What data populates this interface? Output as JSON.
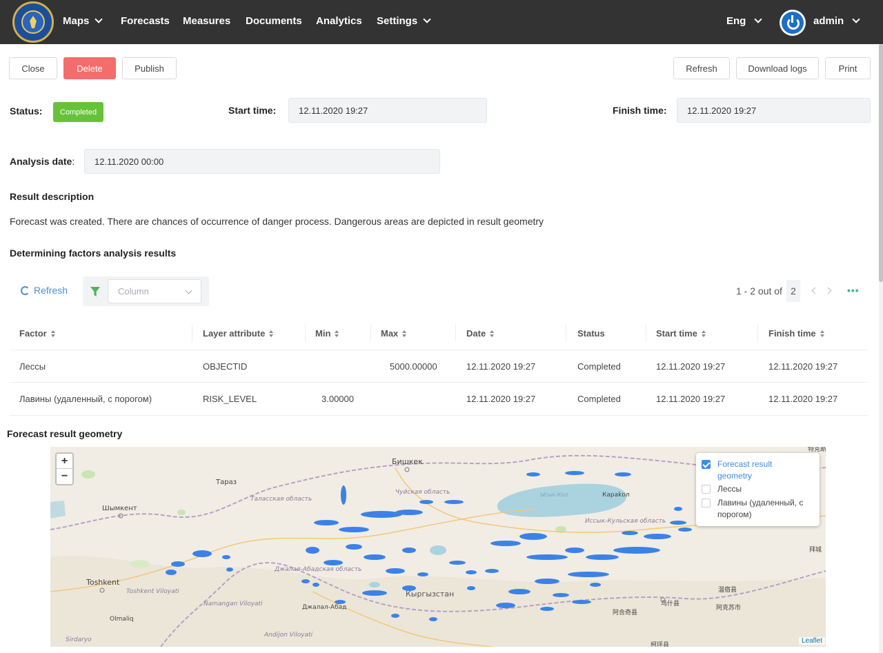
{
  "nav": {
    "items": [
      {
        "label": "Maps",
        "dropdown": true
      },
      {
        "label": "Forecasts",
        "dropdown": false
      },
      {
        "label": "Measures",
        "dropdown": false
      },
      {
        "label": "Documents",
        "dropdown": false
      },
      {
        "label": "Analytics",
        "dropdown": false
      },
      {
        "label": "Settings",
        "dropdown": true
      }
    ],
    "language": "Eng",
    "user": "admin"
  },
  "actions": {
    "close": "Close",
    "delete": "Delete",
    "publish": "Publish",
    "refresh": "Refresh",
    "download_logs": "Download logs",
    "print": "Print"
  },
  "details": {
    "status_label": "Status:",
    "status_value": "Completed",
    "start_label": "Start time:",
    "start_value": "12.11.2020 19:27",
    "finish_label": "Finish time:",
    "finish_value": "12.11.2020 19:27",
    "analysis_label": "Analysis date",
    "analysis_colon": ":",
    "analysis_value": "12.11.2020 00:00"
  },
  "result": {
    "title": "Result description",
    "text": "Forecast was created. There are chances of occurrence of danger process. Dangerous areas are depicted in result geometry"
  },
  "factors": {
    "title": "Determining factors analysis results",
    "refresh_label": "Refresh",
    "column_placeholder": "Column",
    "pager_text": "1 - 2 out of",
    "pager_total": "2",
    "more": "•••",
    "columns": [
      "Factor",
      "Layer attribute",
      "Min",
      "Max",
      "Date",
      "Status",
      "Start time",
      "Finish time"
    ],
    "rows": [
      {
        "factor": "Лессы",
        "attribute": "OBJECTID",
        "min": "",
        "max": "5000.00000",
        "date": "12.11.2020 19:27",
        "status": "Completed",
        "start": "12.11.2020 19:27",
        "finish": "12.11.2020 19:27"
      },
      {
        "factor": "Лавины (удаленный, с порогом)",
        "attribute": "RISK_LEVEL",
        "min": "3.00000",
        "max": "",
        "date": "12.11.2020 19:27",
        "status": "Completed",
        "start": "12.11.2020 19:27",
        "finish": "12.11.2020 19:27"
      }
    ]
  },
  "map": {
    "title": "Forecast result geometry",
    "zoom_in": "+",
    "zoom_out": "−",
    "attribution": "Leaflet",
    "legend": [
      {
        "label": "Forecast result geometry",
        "checked": true
      },
      {
        "label": "Лессы",
        "checked": false
      },
      {
        "label": "Лавины (удаленный, с порогом)",
        "checked": false
      }
    ],
    "place_labels": [
      "Бишкек",
      "Тараз",
      "Шымкент",
      "Чуйская область",
      "Таласская область",
      "Караkол",
      "Ысык-Кол",
      "Иссык-Кульская область",
      "Toshkent",
      "Toshkent Viloyati",
      "Джалал-Абадская область",
      "Кыргызстан",
      "Namangan Viloyati",
      "Джалал-Абад",
      "Olmaliq",
      "Andijon Viloyati",
      "Sirdaryo",
      "阿合奇县",
      "乌什县",
      "温宿县",
      "阿克苏市",
      "拜城",
      "特克斯",
      "柯坪县"
    ],
    "colors": {
      "geometry": "#3b82e8",
      "water": "#aad3df",
      "park": "#c8e6b0",
      "land": "#f1ede4"
    }
  }
}
